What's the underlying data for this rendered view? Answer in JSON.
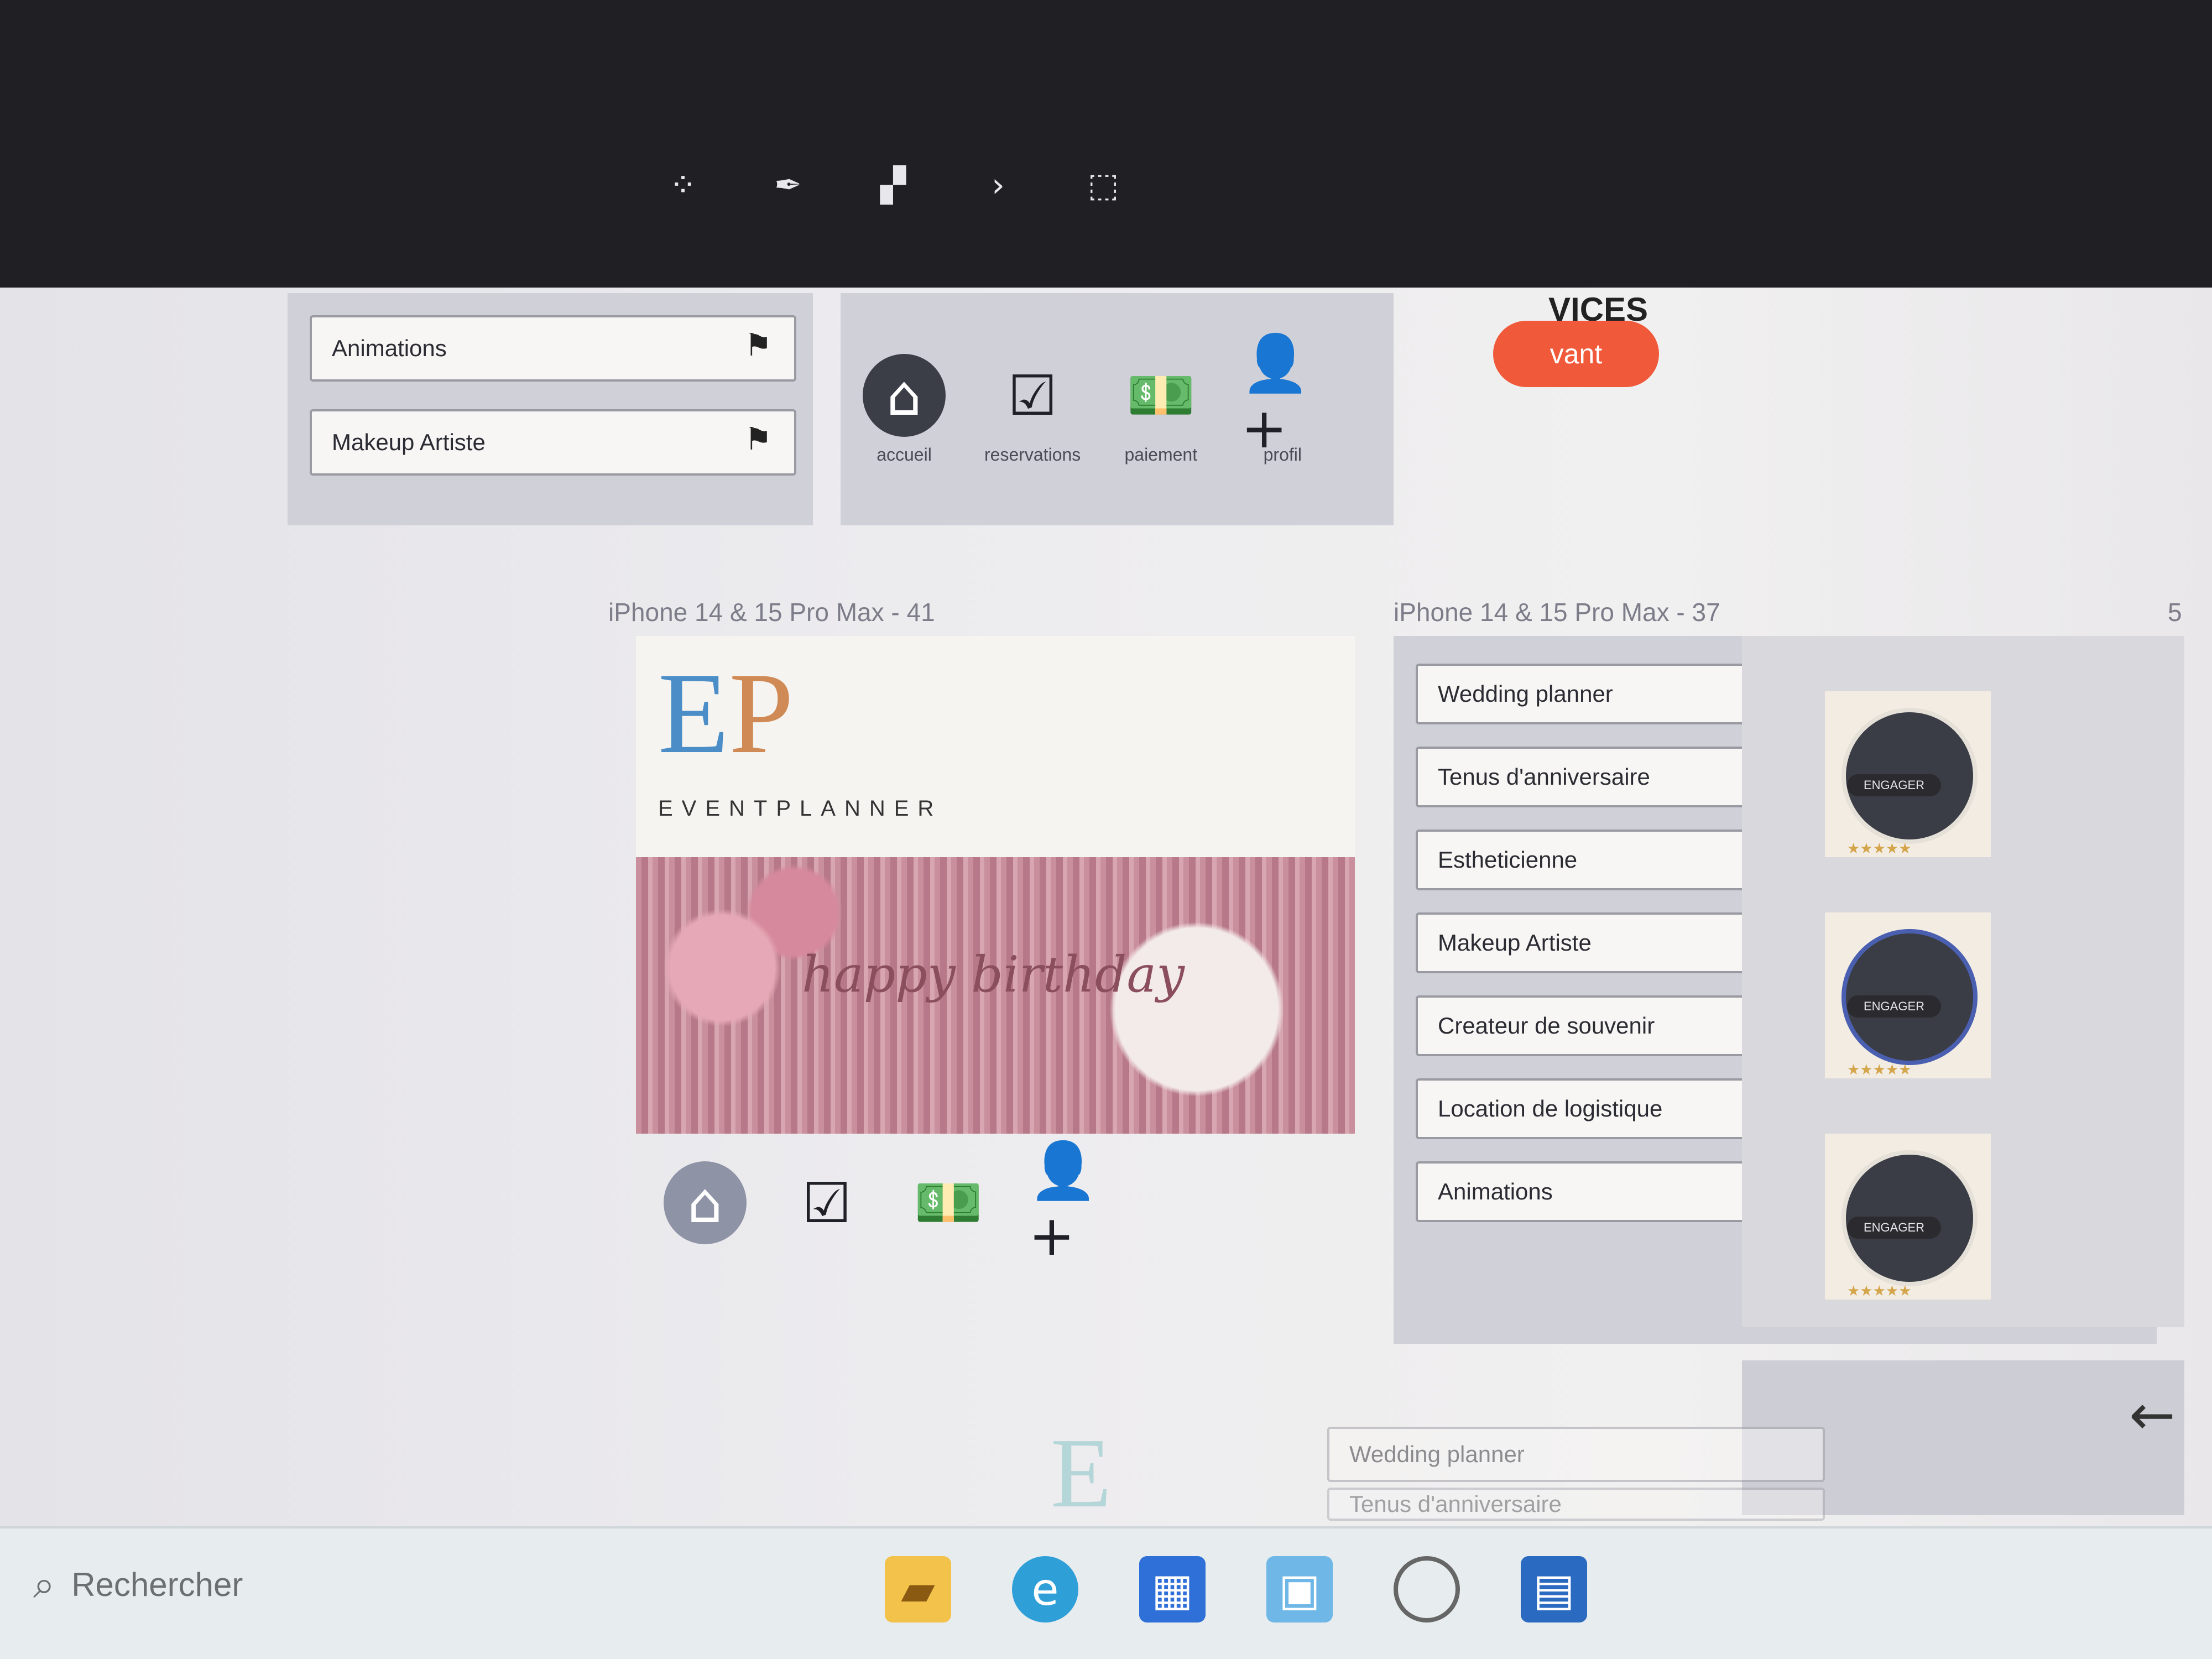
{
  "bezel": {
    "toolbar_icons": [
      "grid-icon",
      "pen-icon",
      "shapes-icon",
      "chevron-icon",
      "frame-icon"
    ]
  },
  "frames": {
    "frame41_label": "iPhone 14 & 15 Pro Max - 41",
    "frame37_label": "iPhone 14 & 15 Pro Max - 37",
    "frame5_label": "5"
  },
  "frame41": {
    "logo_e": "E",
    "logo_p": "P",
    "logo_word": "EVENTPLANNER",
    "photo_caption": "happy birthday",
    "nav": [
      {
        "icon": "home-icon",
        "glyph": "⌂",
        "label": ""
      },
      {
        "icon": "reservation-icon",
        "glyph": "☑",
        "label": ""
      },
      {
        "icon": "payment-icon",
        "glyph": "💵",
        "label": ""
      },
      {
        "icon": "add-user-icon",
        "glyph": "👤+",
        "label": ""
      }
    ]
  },
  "top_nav": [
    {
      "icon": "home-icon",
      "glyph": "⌂",
      "label": "accueil"
    },
    {
      "icon": "reservation-icon",
      "glyph": "☑",
      "label": "reservations"
    },
    {
      "icon": "payment-icon",
      "glyph": "💵",
      "label": "paiement"
    },
    {
      "icon": "add-user-icon",
      "glyph": "👤+",
      "label": "profil"
    }
  ],
  "top_cards": [
    "Animations",
    "Makeup Artiste"
  ],
  "frame37": {
    "items": [
      "Wedding planner",
      "Tenus d'anniversaire",
      "Estheticienne",
      "Makeup Artiste",
      "Createur de souvenir",
      "Location de logistique",
      "Animations"
    ]
  },
  "frame5": {
    "profiles": [
      {
        "badge": "ENGAGER",
        "stars": "★★★★★"
      },
      {
        "badge": "ENGAGER",
        "stars": "★★★★★"
      },
      {
        "badge": "ENGAGER",
        "stars": "★★★★★"
      }
    ]
  },
  "left_partial": {
    "heading": "VICES",
    "button": "vant"
  },
  "bottom_partial": {
    "cards": [
      "Wedding planner",
      "Tenus d'anniversaire"
    ],
    "letter": "E"
  },
  "taskbar": {
    "search_placeholder": "Rechercher",
    "apps": [
      "file-explorer-icon",
      "edge-icon",
      "store-icon",
      "photos-icon",
      "circle-icon",
      "app-icon"
    ]
  }
}
